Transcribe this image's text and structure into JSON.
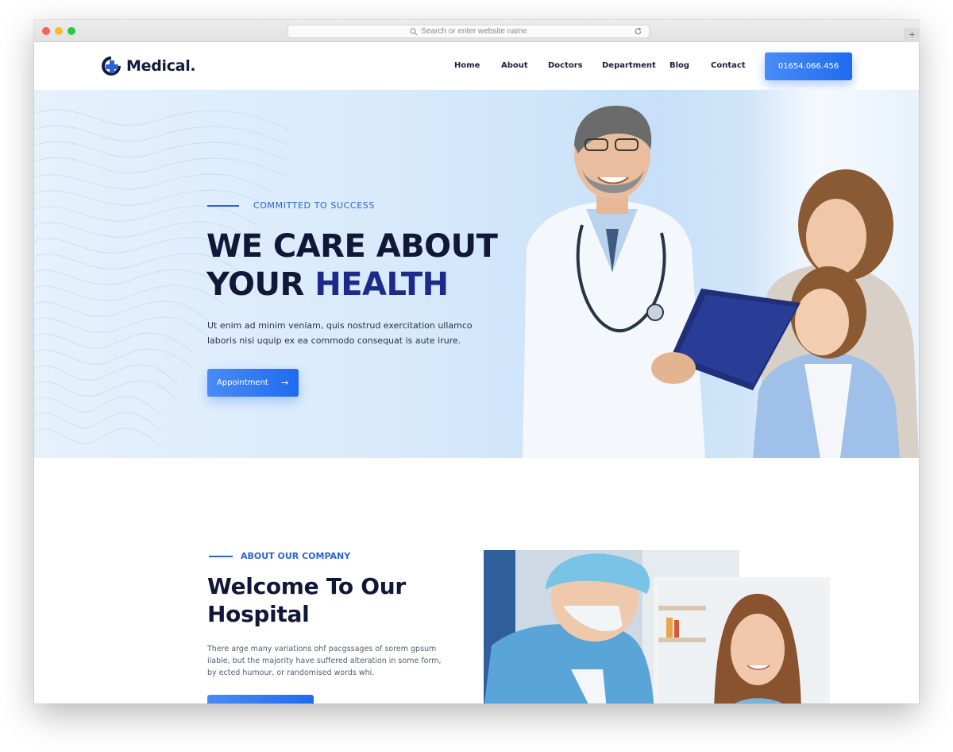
{
  "browser": {
    "url_placeholder": "Search or enter website name",
    "new_tab_label": "+"
  },
  "brand": {
    "name": "Medical.",
    "accent": "#2a63d8",
    "dark": "#111736",
    "button_blue": "#1f6bf0"
  },
  "nav": {
    "items": [
      {
        "label": "Home"
      },
      {
        "label": "About"
      },
      {
        "label": "Doctors"
      },
      {
        "label": "Department"
      },
      {
        "label": "Blog"
      },
      {
        "label": "Contact"
      }
    ],
    "phone": "01654.066.456"
  },
  "hero": {
    "eyebrow": "COMMITTED TO SUCCESS",
    "title_line1": "WE CARE ABOUT",
    "title_line2_a": "YOUR ",
    "title_line2_b": "HEALTH",
    "text": "Ut enim ad minim veniam, quis nostrud exercitation ullamco laboris nisi uquip ex ea commodo consequat is aute irure.",
    "button": "Appointment",
    "button_icon": "arrow-right-icon"
  },
  "about": {
    "eyebrow": "ABOUT OUR COMPANY",
    "title_line1": "Welcome To Our",
    "title_line2": "Hospital",
    "text": "There arge many variations ohf pacgssages of sorem gpsum ilable, but the majority have suffered alteration in some form, by ected humour, or randomised words whi."
  }
}
